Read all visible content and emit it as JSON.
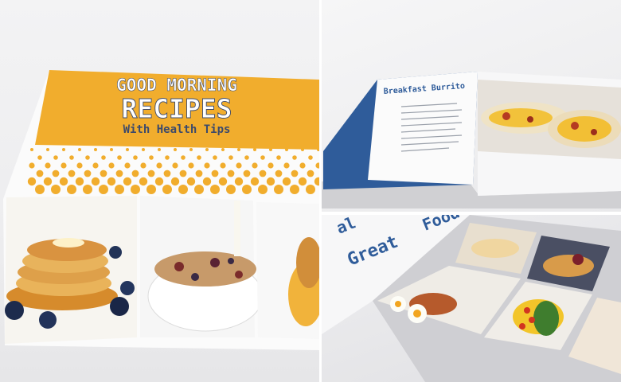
{
  "cover": {
    "title_line1": "GOOD MORNING",
    "title_line2": "RECIPES",
    "title_line3": "With Health Tips"
  },
  "open_book": {
    "recipe_title": "Breakfast Burrito"
  },
  "spread": {
    "word_top": "Food",
    "word_left": "al",
    "word_bottom": "Great"
  },
  "colors": {
    "cover_yellow": "#f1ad2d",
    "page_blue": "#2f5c9a",
    "title_text": "#ffffff",
    "title_shadow": "#3c4a6b"
  }
}
